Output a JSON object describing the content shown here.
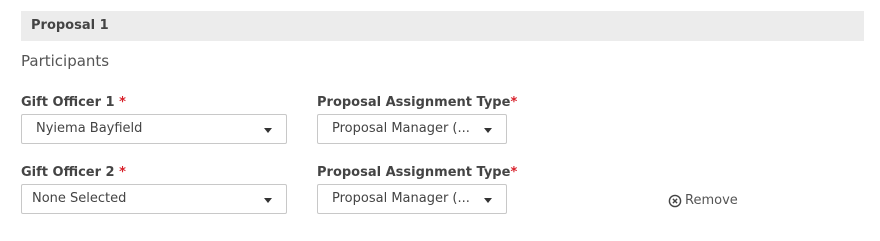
{
  "proposal": {
    "title": "Proposal 1",
    "participants_heading": "Participants",
    "rows": [
      {
        "officer_label": "Gift Officer 1",
        "officer_required": "*",
        "officer_value": "Nyiema Bayfield",
        "type_label": "Proposal Assignment Type",
        "type_required": "*",
        "type_value": "Proposal Manager (..."
      },
      {
        "officer_label": "Gift Officer 2",
        "officer_required": "*",
        "officer_value": "None Selected",
        "type_label": "Proposal Assignment Type",
        "type_required": "*",
        "type_value": "Proposal Manager (..."
      }
    ],
    "remove_label": "Remove"
  },
  "icons": {
    "caret": "chevron-down-icon",
    "remove": "circle-x-icon"
  },
  "colors": {
    "required": "#d8202a",
    "header_bg": "#ececec"
  }
}
